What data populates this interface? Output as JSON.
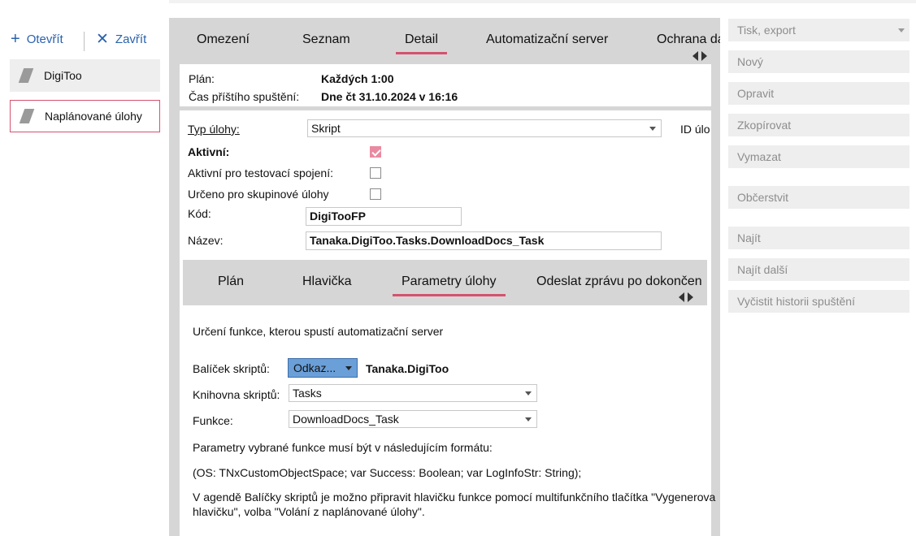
{
  "left": {
    "open_label": "Otevřít",
    "close_label": "Zavřít",
    "items": [
      {
        "label": "DigiToo"
      },
      {
        "label": "Naplánované úlohy"
      }
    ]
  },
  "tabs": {
    "omezeni": "Omezení",
    "seznam": "Seznam",
    "detail": "Detail",
    "server": "Automatizační server",
    "ochrana": "Ochrana da"
  },
  "info": {
    "plan_label": "Plán:",
    "plan_value": "Každých 1:00",
    "next_label": "Čas příštího spuštění:",
    "next_value": "Dne čt 31.10.2024 v 16:16"
  },
  "form": {
    "typ_label": "Typ úlohy:",
    "typ_value": "Skript",
    "id_label": "ID úlo",
    "aktivni_label": "Aktivní:",
    "aktivni_checked": true,
    "test_label": "Aktivní pro testovací spojení:",
    "test_checked": false,
    "skup_label": "Určeno pro skupinové úlohy",
    "skup_checked": false,
    "kod_label": "Kód:",
    "kod_value": "DigiTooFP",
    "nazev_label": "Název:",
    "nazev_value": "Tanaka.DigiToo.Tasks.DownloadDocs_Task"
  },
  "subtabs": {
    "plan": "Plán",
    "hlavicka": "Hlavička",
    "parametry": "Parametry úlohy",
    "odeslat": "Odeslat zprávu po dokončen"
  },
  "params": {
    "intro": "Určení funkce, kterou spustí automatizační server",
    "balicek_label": "Balíček skriptů:",
    "odkaz_button": "Odkaz...",
    "balicek_value": "Tanaka.DigiToo",
    "knihovna_label": "Knihovna skriptů:",
    "knihovna_value": "Tasks",
    "funkce_label": "Funkce:",
    "funkce_value": "DownloadDocs_Task",
    "format_note": "Parametry vybrané funkce musí být v následujícím formátu:",
    "signature": "(OS: TNxCustomObjectSpace; var Success: Boolean; var LogInfoStr: String);",
    "hint_line1": "V agendě Balíčky skriptů je možno připravit hlavičku funkce pomocí multifunkčního tlačítka \"Vygenerova",
    "hint_line2": "hlavičku\", volba \"Volání z naplánované úlohy\"."
  },
  "actions": {
    "tisk": "Tisk, export",
    "novy": "Nový",
    "opravit": "Opravit",
    "zkopirovat": "Zkopírovat",
    "vymazat": "Vymazat",
    "obcerstvit": "Občerstvit",
    "najit": "Najít",
    "najit_dalsi": "Najít další",
    "vycistit": "Vyčistit historii spuštění"
  },
  "colors": {
    "accent": "#d4526e",
    "link": "#2a62ad",
    "tabbar": "#d6d6d6",
    "button_blue": "#6a9fd8"
  }
}
